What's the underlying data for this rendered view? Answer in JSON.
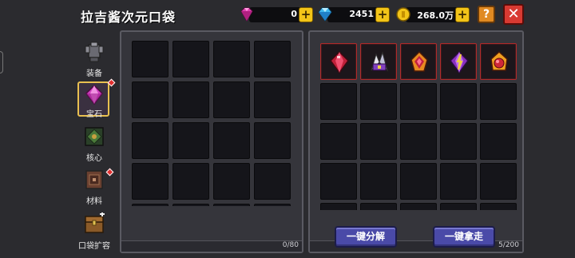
{
  "header": {
    "title": "拉吉酱次元口袋"
  },
  "currencies": [
    {
      "name": "pink-gem",
      "value": "0",
      "color": "#e040b0"
    },
    {
      "name": "blue-gem",
      "value": "2451",
      "color": "#40b8f0"
    },
    {
      "name": "gold-coin",
      "value": "268.0万",
      "color": "#f2c418"
    }
  ],
  "buttons": {
    "help": "?",
    "close": "✕",
    "plus": "+"
  },
  "sidebar": {
    "items": [
      {
        "label": "装备",
        "icon": "armor-icon",
        "active": false,
        "badge": false
      },
      {
        "label": "宝石",
        "icon": "gem-icon",
        "active": true,
        "badge": true
      },
      {
        "label": "核心",
        "icon": "core-icon",
        "active": false,
        "badge": false
      },
      {
        "label": "材料",
        "icon": "material-icon",
        "active": false,
        "badge": true
      },
      {
        "label": "口袋扩容",
        "icon": "chest-icon",
        "active": false,
        "badge": false
      }
    ]
  },
  "left_panel": {
    "count": "0/80"
  },
  "right_panel": {
    "count": "5/200",
    "items": [
      {
        "icon": "ruby-gem-icon"
      },
      {
        "icon": "crystal-gem-icon"
      },
      {
        "icon": "flame-gem-icon"
      },
      {
        "icon": "amethyst-gem-icon"
      },
      {
        "icon": "fire-orb-gem-icon"
      }
    ]
  },
  "actions": {
    "decompose": "一键分解",
    "take_all": "一键拿走"
  }
}
